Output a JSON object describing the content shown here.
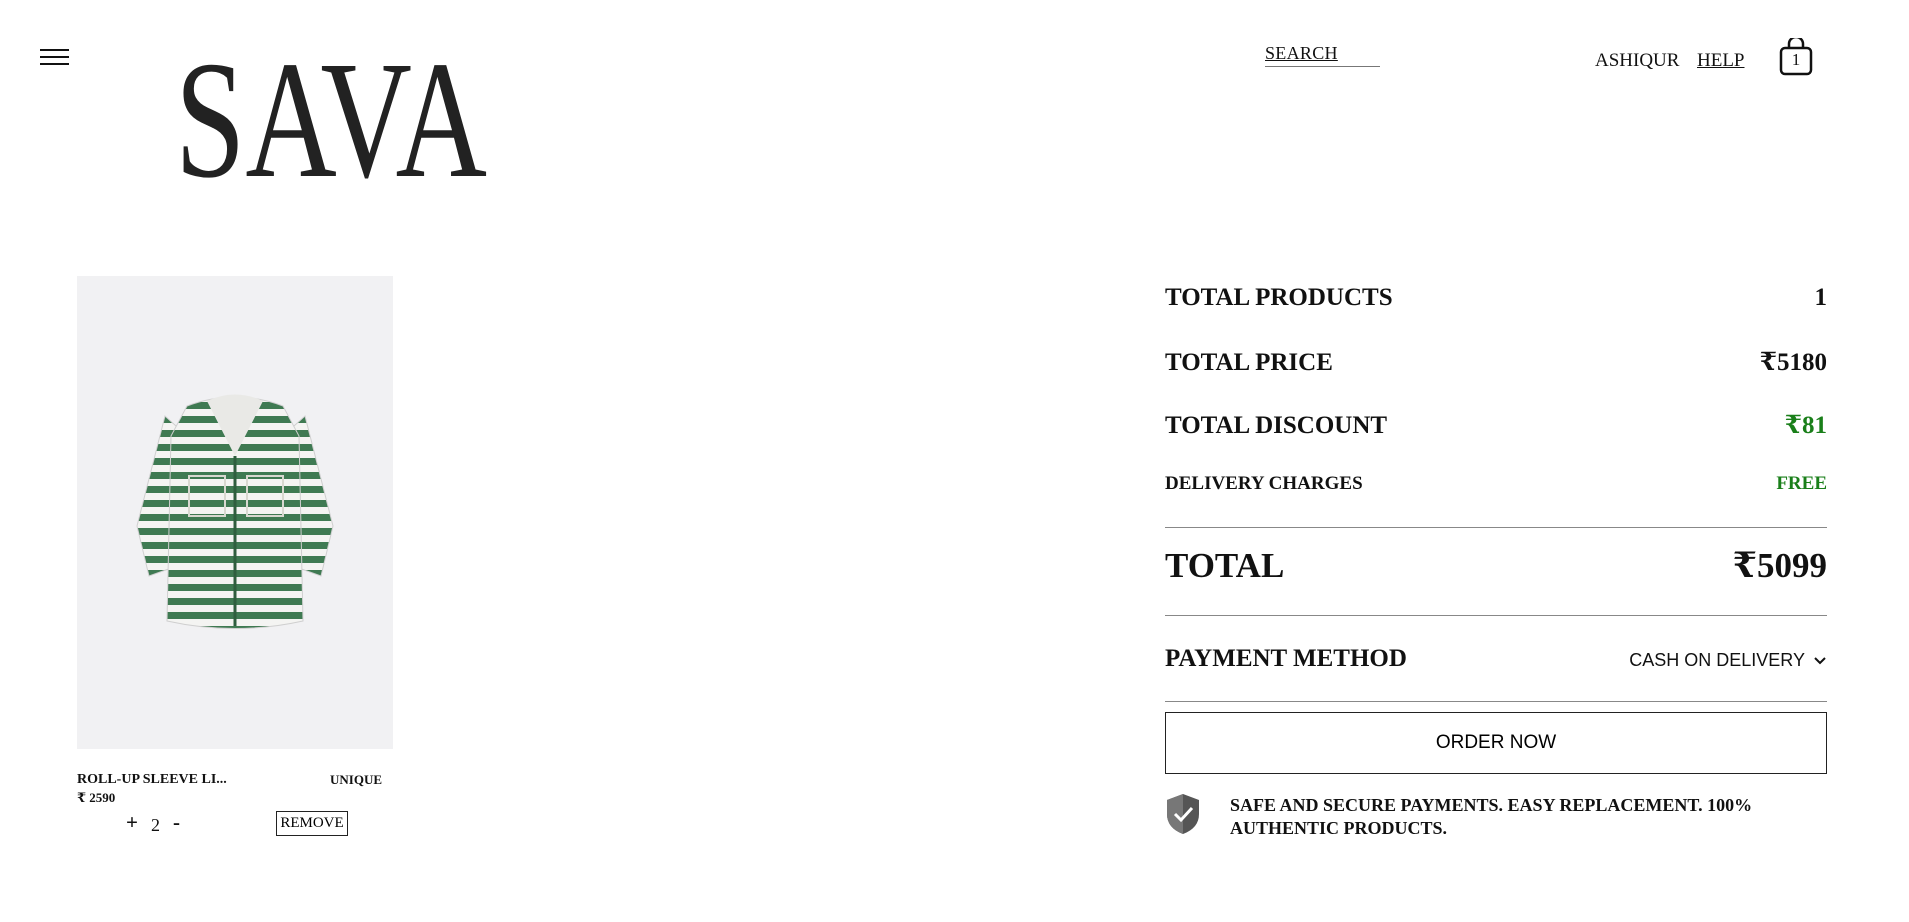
{
  "header": {
    "brand": "SAVA",
    "search_label": "SEARCH",
    "user_name": "ASHIQUR",
    "help_label": "HELP",
    "cart_count": "1"
  },
  "cart": {
    "items": [
      {
        "name": "ROLL-UP SLEEVE LI...",
        "tag": "UNIQUE",
        "price": "₹ 2590",
        "quantity": "2",
        "plus_label": "+",
        "minus_label": "-",
        "remove_label": "REMOVE"
      }
    ]
  },
  "summary": {
    "total_products_label": "TOTAL PRODUCTS",
    "total_products_value": "1",
    "total_price_label": "TOTAL PRICE",
    "total_price_value": "₹5180",
    "total_discount_label": "TOTAL DISCOUNT",
    "total_discount_value": "₹81",
    "delivery_label": "DELIVERY CHARGES",
    "delivery_value": "FREE",
    "total_label": "TOTAL",
    "total_value": "₹5099",
    "payment_label": "PAYMENT METHOD",
    "payment_value": "CASH ON DELIVERY",
    "order_button": "ORDER NOW",
    "secure_text": "SAFE AND SECURE PAYMENTS. EASY REPLACEMENT. 100% AUTHENTIC PRODUCTS."
  },
  "colors": {
    "accent_green": "#1a7f1a",
    "product_bg": "#f1f1f3",
    "shirt_stripe": "#3f7a52"
  },
  "icons": [
    "hamburger-menu-icon",
    "shopping-bag-icon",
    "chevron-down-icon",
    "shield-check-icon"
  ]
}
